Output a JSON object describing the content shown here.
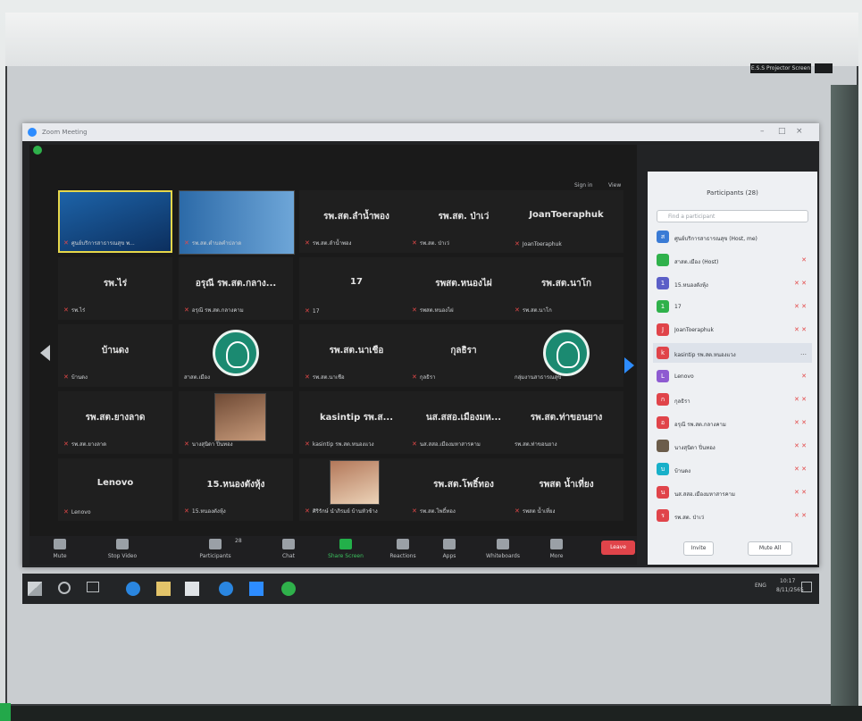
{
  "window": {
    "title": "Zoom Meeting"
  },
  "projector": {
    "label": "E.S.S Projector Screen"
  },
  "topbar": {
    "sign_in": "Sign in",
    "view": "View"
  },
  "tiles": [
    {
      "name": "",
      "label": "ศูนย์บริการสาธารณสุข พ..."
    },
    {
      "name": "",
      "label": "รพ.สต.ตำบลคำปลาด"
    },
    {
      "name": "รพ.สต.ลำน้ำพอง",
      "label": "รพ.สต.ลำน้ำพอง"
    },
    {
      "name": "รพ.สต. ป่าเว่",
      "label": "รพ.สต. ป่าเว่"
    },
    {
      "name": "JoanToeraphuk",
      "label": "JoanToeraphuk"
    },
    {
      "name": "รพ.ไร่",
      "label": "รพ.ไร่"
    },
    {
      "name": "อรุณี รพ.สต.กลาง...",
      "label": "อรุณี รพ.สต.กลางคาม"
    },
    {
      "name": "17",
      "label": "17"
    },
    {
      "name": "รพสต.หนองไผ่",
      "label": "รพสต.หนองไผ่"
    },
    {
      "name": "รพ.สต.นาโก",
      "label": "รพ.สต.นาโก"
    },
    {
      "name": "บ้านดง",
      "label": "บ้านดง"
    },
    {
      "name": "",
      "label": "สาสต.เมือง"
    },
    {
      "name": "รพ.สต.นาเชือ",
      "label": "รพ.สต.นาเชือ"
    },
    {
      "name": "กุลธิรา",
      "label": "กุลธิรา"
    },
    {
      "name": "",
      "label": "กลุ่มงานสาธารณสุข"
    },
    {
      "name": "รพ.สต.ยางลาด",
      "label": "รพ.สต.ยางลาด"
    },
    {
      "name": "",
      "label": "นางสุนิดา ปิ่นทอง"
    },
    {
      "name": "kasintip รพ.ส...",
      "label": "kasintip รพ.สต.หนองแวง"
    },
    {
      "name": "นส.สสอ.เมืองมห...",
      "label": "นส.สสอ.เมืองมหาสารคาม"
    },
    {
      "name": "รพ.สต.ท่าขอนยาง",
      "label": "รพ.สต.ท่าขอนยาง"
    },
    {
      "name": "Lenovo",
      "label": "Lenovo"
    },
    {
      "name": "15.หนองตังหุ้ง",
      "label": "15.หนองตังหุ้ง"
    },
    {
      "name": "",
      "label": "ศิริรักษ์ นำภิรมย์ บ้านหัวช้าง"
    },
    {
      "name": "รพ.สต.โพธิ์ทอง",
      "label": "รพ.สต.โพธิ์ทอง"
    },
    {
      "name": "รพสต น้ำเที่ยง",
      "label": "รพสต น้ำเที่ยง"
    }
  ],
  "toolbar": {
    "mute": "Mute",
    "video": "Stop Video",
    "participants": "Participants",
    "participants_count": "28",
    "chat": "Chat",
    "share": "Share Screen",
    "reactions": "Reactions",
    "apps": "Apps",
    "whiteboards": "Whiteboards",
    "more": "More",
    "leave": "Leave"
  },
  "panel": {
    "title": "Participants (28)",
    "search_placeholder": "Find a participant",
    "invite": "Invite",
    "mute_all": "Mute All",
    "participants": [
      {
        "initial": "ส",
        "name": "ศูนย์บริการสาธารณสุข (Host, me)",
        "color": "#3a7bd5"
      },
      {
        "initial": "",
        "name": "สาสต.เมือง (Host)",
        "color": "#2fb14b"
      },
      {
        "initial": "1",
        "name": "15.หนองตังหุ้ง",
        "color": "#5b5fc7"
      },
      {
        "initial": "1",
        "name": "17",
        "color": "#2fb14b"
      },
      {
        "initial": "J",
        "name": "JoanToeraphuk",
        "color": "#e0444a"
      },
      {
        "initial": "k",
        "name": "kasintip รพ.สต.หนองแวง",
        "color": "#e0444a"
      },
      {
        "initial": "L",
        "name": "Lenovo",
        "color": "#8e5bd1"
      },
      {
        "initial": "ก",
        "name": "กุลธิรา",
        "color": "#e0444a"
      },
      {
        "initial": "อ",
        "name": "อรุณี รพ.สต.กลางคาม",
        "color": "#e0444a"
      },
      {
        "initial": "",
        "name": "นางสุนิดา ปิ่นทอง",
        "color": "#6b5c4a"
      },
      {
        "initial": "บ",
        "name": "บ้านดง",
        "color": "#18b0c9"
      },
      {
        "initial": "น",
        "name": "นส.สสอ.เมืองมหาสารคาม",
        "color": "#e0444a"
      },
      {
        "initial": "ร",
        "name": "รพ.สต. ป่าเว่",
        "color": "#e0444a"
      }
    ]
  },
  "taskbar": {
    "time": "10:17",
    "date": "8/11/2565",
    "lang": "ENG"
  },
  "colors": {
    "zoom_blue": "#2d8cff",
    "leave_red": "#e0444a",
    "share_green": "#23b04a"
  }
}
